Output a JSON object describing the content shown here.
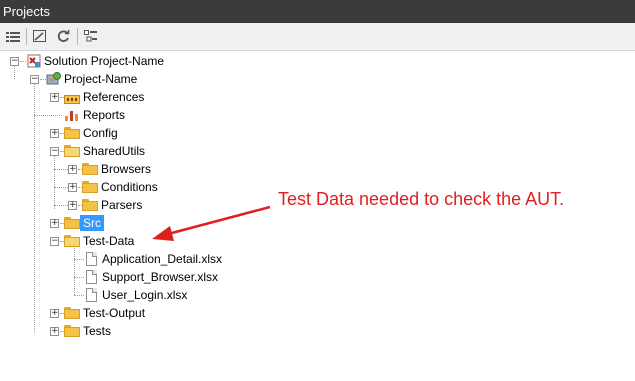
{
  "window": {
    "title": "Projects"
  },
  "toolbar": {
    "buttons": [
      "properties-icon",
      "show-all-files-icon",
      "refresh-icon",
      "collapse-all-icon"
    ]
  },
  "tree": {
    "solution": "Solution Project-Name",
    "project": "Project-Name",
    "references": "References",
    "reports": "Reports",
    "config": "Config",
    "shared_utils": "SharedUtils",
    "browsers": "Browsers",
    "conditions": "Conditions",
    "parsers": "Parsers",
    "src": "Src",
    "test_data": "Test-Data",
    "file1": "Application_Detail.xlsx",
    "file2": "Support_Browser.xlsx",
    "file3": "User_Login.xlsx",
    "test_output": "Test-Output",
    "tests": "Tests",
    "selected": "Src"
  },
  "annotation": {
    "text": "Test Data needed to check the AUT.",
    "color": "#e02020"
  }
}
